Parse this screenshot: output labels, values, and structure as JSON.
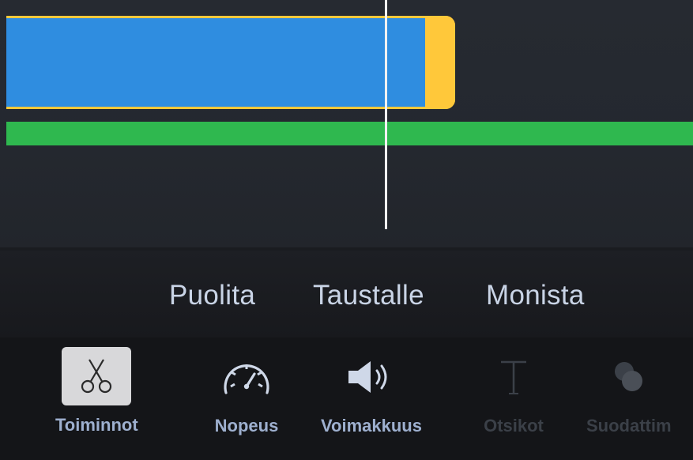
{
  "actions": {
    "split": "Puolita",
    "detach": "Taustalle",
    "duplicate": "Monista"
  },
  "toolbar": {
    "tools": [
      {
        "label": "Toiminnot",
        "icon": "scissors-icon",
        "selected": true
      },
      {
        "label": "Nopeus",
        "icon": "speedometer-icon",
        "selected": false
      },
      {
        "label": "Voimakkuus",
        "icon": "speaker-icon",
        "selected": false
      },
      {
        "label": "Otsikot",
        "icon": "title-t-icon",
        "selected": false
      },
      {
        "label": "Suodattim",
        "icon": "filter-circles-icon",
        "selected": false
      }
    ]
  },
  "colors": {
    "video_clip": "#2f8de0",
    "selection_border": "#ffc83a",
    "audio_track": "#2fb84f",
    "playhead": "#f2f2f2",
    "action_text": "#c9d4e6",
    "tool_label": "#9eb0cf"
  }
}
